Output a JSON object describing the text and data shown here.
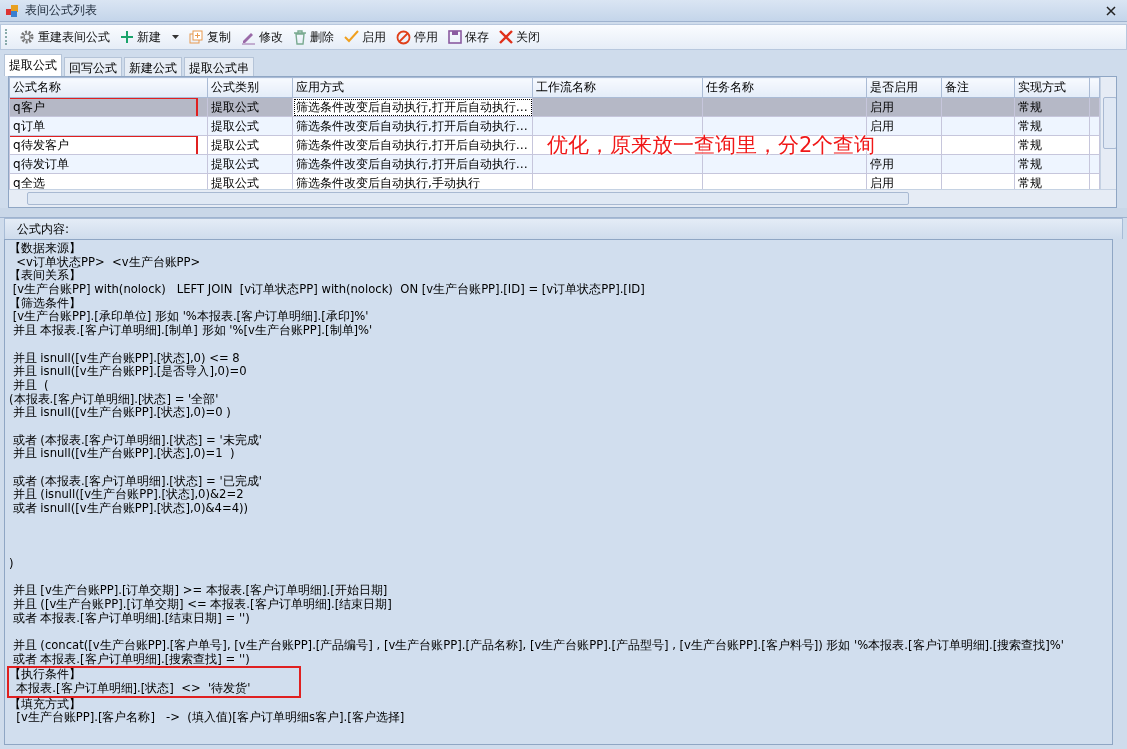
{
  "window": {
    "title": "表间公式列表"
  },
  "toolbar": [
    {
      "kind": "gear",
      "label": "重建表间公式"
    },
    {
      "kind": "plus",
      "label": "新建",
      "dropdown": true
    },
    {
      "kind": "copy",
      "label": "复制"
    },
    {
      "kind": "pencil",
      "label": "修改"
    },
    {
      "kind": "trash",
      "label": "删除"
    },
    {
      "kind": "check",
      "label": "启用"
    },
    {
      "kind": "ban",
      "label": "停用"
    },
    {
      "kind": "save",
      "label": "保存"
    },
    {
      "kind": "close",
      "label": "关闭"
    }
  ],
  "tabs": [
    {
      "label": "提取公式",
      "selected": true
    },
    {
      "label": "回写公式",
      "selected": false
    },
    {
      "label": "新建公式",
      "selected": false
    },
    {
      "label": "提取公式串",
      "selected": false
    }
  ],
  "table": {
    "columns": [
      "公式名称",
      "公式类别",
      "应用方式",
      "工作流名称",
      "任务名称",
      "是否启用",
      "备注",
      "实现方式"
    ],
    "rows": [
      {
        "name": "q客户",
        "category": "提取公式",
        "apply": "筛选条件改变后自动执行,打开后自动执行…",
        "enabled": "启用",
        "impl": "常规",
        "selected": true,
        "marked": true
      },
      {
        "name": "q订单",
        "category": "提取公式",
        "apply": "筛选条件改变后自动执行,打开后自动执行…",
        "enabled": "启用",
        "impl": "常规",
        "selected": false,
        "marked": false
      },
      {
        "name": "q待发客户",
        "category": "提取公式",
        "apply": "筛选条件改变后自动执行,打开后自动执行…",
        "impl": "常规",
        "selected": false,
        "marked": true
      },
      {
        "name": "q待发订单",
        "category": "提取公式",
        "apply": "筛选条件改变后自动执行,打开后自动执行…",
        "enabled": "停用",
        "impl": "常规",
        "selected": false,
        "marked": false
      },
      {
        "name": "q全选",
        "category": "提取公式",
        "apply": "筛选条件改变后自动执行,手动执行",
        "enabled": "启用",
        "impl": "常规",
        "selected": false,
        "marked": false
      }
    ]
  },
  "annotation": "优化，原来放一查询里，分2个查询",
  "formula": {
    "label": "公式内容:",
    "lines": [
      {
        "kind": "text",
        "text": "【数据来源】",
        "marked": false
      },
      {
        "kind": "text",
        "text": "  <v订单状态PP>  <v生产台账PP>",
        "marked": false
      },
      {
        "kind": "text",
        "text": "【表间关系】",
        "marked": false
      },
      {
        "kind": "text",
        "text": " [v生产台账PP] with(nolock)   LEFT JOIN  [v订单状态PP] with(nolock)  ON [v生产台账PP].[ID] = [v订单状态PP].[ID]",
        "marked": false
      },
      {
        "kind": "text",
        "text": "【筛选条件】",
        "marked": false
      },
      {
        "kind": "text",
        "text": " [v生产台账PP].[承印单位] 形如 '%本报表.[客户订单明细].[承印]%'",
        "marked": false
      },
      {
        "kind": "text",
        "text": " 并且 本报表.[客户订单明细].[制单] 形如 '%[v生产台账PP].[制单]%'",
        "marked": false
      },
      {
        "kind": "blank"
      },
      {
        "kind": "text",
        "text": " 并且 isnull([v生产台账PP].[状态],0) <= 8",
        "marked": false
      },
      {
        "kind": "text",
        "text": " 并且 isnull([v生产台账PP].[是否导入],0)=0",
        "marked": false
      },
      {
        "kind": "text",
        "text": " 并且  (",
        "marked": false
      },
      {
        "kind": "text",
        "text": "(本报表.[客户订单明细].[状态] = '全部'",
        "marked": false
      },
      {
        "kind": "text",
        "text": " 并且 isnull([v生产台账PP].[状态],0)=0 )",
        "marked": false
      },
      {
        "kind": "blank"
      },
      {
        "kind": "text",
        "text": " 或者 (本报表.[客户订单明细].[状态] = '未完成'",
        "marked": false
      },
      {
        "kind": "text",
        "text": " 并且 isnull([v生产台账PP].[状态],0)=1  )",
        "marked": false
      },
      {
        "kind": "blank"
      },
      {
        "kind": "text",
        "text": " 或者 (本报表.[客户订单明细].[状态] = '已完成'",
        "marked": false
      },
      {
        "kind": "text",
        "text": " 并且 (isnull([v生产台账PP].[状态],0)&2=2",
        "marked": false
      },
      {
        "kind": "text",
        "text": " 或者 isnull([v生产台账PP].[状态],0)&4=4))",
        "marked": false
      },
      {
        "kind": "blank"
      },
      {
        "kind": "blank"
      },
      {
        "kind": "blank"
      },
      {
        "kind": "text",
        "text": ")",
        "marked": false
      },
      {
        "kind": "blank"
      },
      {
        "kind": "text",
        "text": " 并且 [v生产台账PP].[订单交期] >= 本报表.[客户订单明细].[开始日期]",
        "marked": false
      },
      {
        "kind": "text",
        "text": " 并且 ([v生产台账PP].[订单交期] <= 本报表.[客户订单明细].[结束日期]",
        "marked": false
      },
      {
        "kind": "text",
        "text": " 或者 本报表.[客户订单明细].[结束日期] = '')",
        "marked": false
      },
      {
        "kind": "blank"
      },
      {
        "kind": "text",
        "text": " 并且 (concat([v生产台账PP].[客户单号], [v生产台账PP].[产品编号] , [v生产台账PP].[产品名称], [v生产台账PP].[产品型号] , [v生产台账PP].[客户料号]) 形如 '%本报表.[客户订单明细].[搜索查找]%'",
        "marked": false
      },
      {
        "kind": "text",
        "text": " 或者 本报表.[客户订单明细].[搜索查找] = '')",
        "marked": false
      },
      {
        "kind": "text",
        "text": "【执行条件】",
        "marked": true
      },
      {
        "kind": "text",
        "text": "  本报表.[客户订单明细].[状态]  <>  '待发货'",
        "marked": true
      },
      {
        "kind": "text",
        "text": "【填充方式】",
        "marked": false
      },
      {
        "kind": "text",
        "text": "  [v生产台账PP].[客户名称]   ->  (填入值)[客户订单明细s客户].[客户选择]",
        "marked": false
      }
    ]
  }
}
